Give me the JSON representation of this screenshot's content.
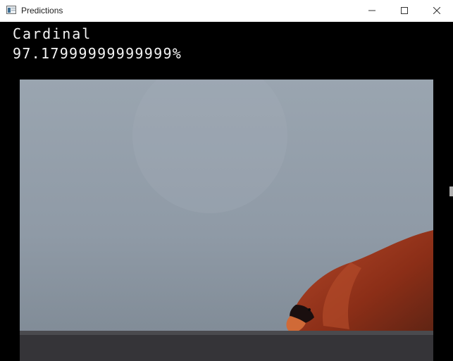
{
  "window": {
    "title": "Predictions",
    "icon": "app-window-icon"
  },
  "controls": {
    "minimize_icon": "minimize-icon",
    "maximize_icon": "maximize-icon",
    "close_icon": "close-icon"
  },
  "prediction": {
    "label": "Cardinal",
    "confidence": "97.17999999999999%"
  },
  "camera": {
    "scene": "webcam-frame-cardinal",
    "colors": {
      "wall": "#8f9aa5",
      "bird": "#9a3a1f",
      "beak": "#d06a37"
    }
  }
}
